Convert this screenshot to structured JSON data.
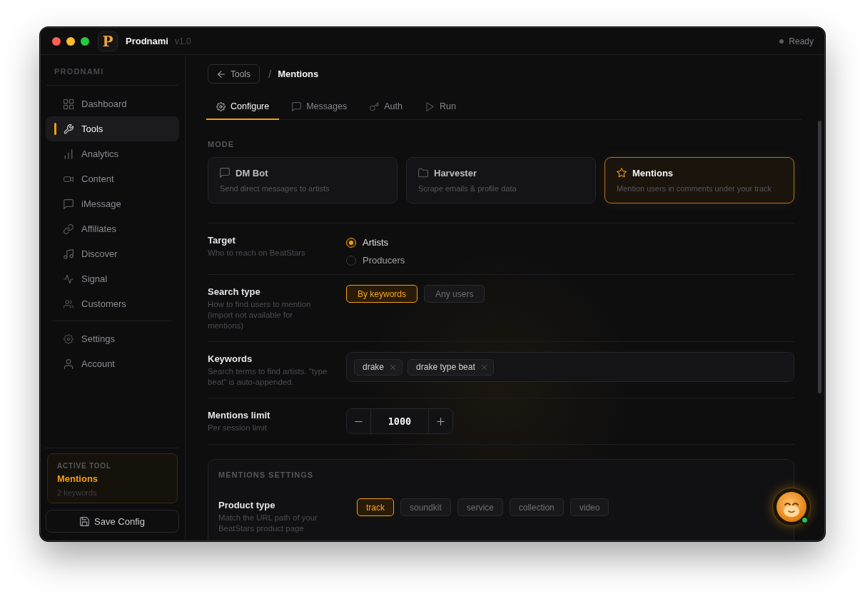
{
  "window": {
    "logo": "P",
    "title": "Prodnami",
    "version": "v1.0",
    "status": "Ready"
  },
  "sidebar": {
    "heading": "PRODNAMI",
    "items": [
      {
        "label": "Dashboard",
        "selected": false
      },
      {
        "label": "Tools",
        "selected": true
      },
      {
        "label": "Analytics",
        "selected": false
      },
      {
        "label": "Content",
        "selected": false
      },
      {
        "label": "iMessage",
        "selected": false
      },
      {
        "label": "Affiliates",
        "selected": false
      },
      {
        "label": "Discover",
        "selected": false
      },
      {
        "label": "Signal",
        "selected": false
      },
      {
        "label": "Customers",
        "selected": false
      }
    ],
    "footer_items": [
      {
        "label": "Settings",
        "selected": false
      },
      {
        "label": "Account",
        "selected": false
      }
    ],
    "active_tool": {
      "heading": "ACTIVE TOOL",
      "name": "Mentions",
      "detail": "2 keywords"
    },
    "save_button": "Save Config"
  },
  "breadcrumb": {
    "back": "Tools",
    "separator": "/",
    "current": "Mentions"
  },
  "tabs": [
    {
      "label": "Configure",
      "selected": true
    },
    {
      "label": "Messages",
      "selected": false
    },
    {
      "label": "Auth",
      "selected": false
    },
    {
      "label": "Run",
      "selected": false
    }
  ],
  "mode": {
    "heading": "MODE",
    "cards": [
      {
        "title": "DM Bot",
        "description": "Send direct messages to artists",
        "selected": false
      },
      {
        "title": "Harvester",
        "description": "Scrape emails & profile data",
        "selected": false
      },
      {
        "title": "Mentions",
        "description": "Mention users in comments under your track",
        "selected": true
      }
    ]
  },
  "settings": [
    {
      "kind": "radio",
      "label": "Target",
      "description": "Who to reach on BeatStars",
      "options": [
        {
          "label": "Artists",
          "selected": true
        },
        {
          "label": "Producers",
          "selected": false
        }
      ]
    },
    {
      "kind": "buttons",
      "label": "Search type",
      "description": "How to find users to mention (import not available for mentions)",
      "options": [
        {
          "label": "By keywords",
          "selected": true
        },
        {
          "label": "Any users",
          "selected": false
        }
      ]
    },
    {
      "kind": "tags",
      "label": "Keywords",
      "description": "Search terms to find artists. \"type beat\" is auto-appended.",
      "tags": [
        "drake",
        "drake type beat"
      ]
    },
    {
      "kind": "stepper",
      "label": "Mentions limit",
      "description": "Per session limit",
      "value": "1000"
    }
  ],
  "mentions_settings": {
    "heading": "MENTIONS SETTINGS",
    "rows": [
      {
        "kind": "buttons",
        "label": "Product type",
        "description": "Match the URL path of your BeatStars product page",
        "options": [
          {
            "label": "track",
            "selected": true
          },
          {
            "label": "soundkit",
            "selected": false
          },
          {
            "label": "service",
            "selected": false
          },
          {
            "label": "collection",
            "selected": false
          },
          {
            "label": "video",
            "selected": false
          }
        ]
      }
    ]
  },
  "assistant": {
    "online": true
  }
}
